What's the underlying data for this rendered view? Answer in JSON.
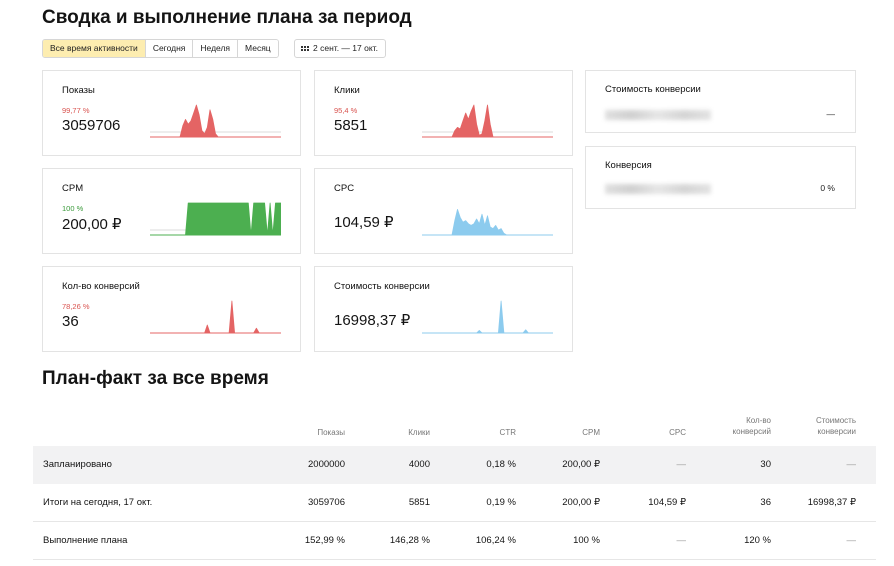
{
  "header": {
    "title": "Сводка и выполнение плана за период"
  },
  "periods": [
    {
      "label": "Все время активности",
      "active": true
    },
    {
      "label": "Сегодня",
      "active": false
    },
    {
      "label": "Неделя",
      "active": false
    },
    {
      "label": "Месяц",
      "active": false
    }
  ],
  "date_range": {
    "icon": "calendar-grid-icon",
    "label": "2 сент. — 17 окт."
  },
  "cards": [
    {
      "id": "shows",
      "label": "Показы",
      "pct": "99,77 %",
      "pct_color": "#d9534f",
      "value": "3059706",
      "spark_color": "#e46464",
      "series": [
        0,
        0,
        0,
        0,
        0,
        0,
        0,
        0,
        0,
        0,
        0,
        0,
        0.35,
        0.55,
        0.4,
        0.5,
        0.75,
        1,
        0.7,
        0.2,
        0.1,
        0.3,
        0.85,
        0.55,
        0.1,
        0,
        0,
        0,
        0,
        0,
        0,
        0,
        0,
        0,
        0,
        0,
        0,
        0,
        0,
        0,
        0,
        0,
        0,
        0,
        0,
        0,
        0,
        0,
        0
      ]
    },
    {
      "id": "clicks",
      "label": "Клики",
      "pct": "95,4 %",
      "pct_color": "#d9534f",
      "value": "5851",
      "spark_color": "#e46464",
      "series": [
        0,
        0,
        0,
        0,
        0,
        0,
        0,
        0,
        0,
        0,
        0,
        0,
        0.2,
        0.3,
        0.25,
        0.5,
        0.75,
        0.55,
        0.8,
        1,
        0.4,
        0.05,
        0.1,
        0.5,
        1,
        0.4,
        0,
        0,
        0,
        0,
        0,
        0,
        0,
        0,
        0,
        0,
        0,
        0,
        0,
        0,
        0,
        0,
        0,
        0,
        0,
        0,
        0,
        0,
        0
      ]
    },
    {
      "id": "cpm",
      "label": "CPM",
      "pct": "100 %",
      "pct_color": "#3a9a3a",
      "value": "200,00 ₽",
      "spark_color": "#4caf50",
      "series": [
        0,
        0,
        0,
        0,
        0,
        0,
        0,
        0,
        0,
        0,
        0,
        0,
        0,
        0,
        1,
        1,
        1,
        1,
        1,
        1,
        1,
        1,
        1,
        1,
        1,
        1,
        1,
        1,
        1,
        1,
        1,
        1,
        1,
        1,
        1,
        1,
        1,
        0,
        1,
        1,
        1,
        1,
        1,
        0,
        1,
        0,
        1,
        1,
        1
      ]
    },
    {
      "id": "cpc",
      "label": "CPC",
      "pct": "",
      "pct_color": "#d9534f",
      "value": "104,59 ₽",
      "spark_color": "#8ccbee",
      "series": [
        0,
        0,
        0,
        0,
        0,
        0,
        0,
        0,
        0,
        0,
        0,
        0,
        0.45,
        0.8,
        0.55,
        0.4,
        0.45,
        0.35,
        0.3,
        0.35,
        0.5,
        0.35,
        0.65,
        0.3,
        0.6,
        0.25,
        0.2,
        0.3,
        0.15,
        0.2,
        0.05,
        0,
        0,
        0,
        0,
        0,
        0,
        0,
        0,
        0,
        0,
        0,
        0,
        0,
        0,
        0,
        0,
        0,
        0
      ]
    },
    {
      "id": "conversions",
      "label": "Кол-во конверсий",
      "pct": "78,26 %",
      "pct_color": "#d9534f",
      "value": "36",
      "spark_color": "#e46464",
      "series": [
        0,
        0,
        0,
        0,
        0,
        0,
        0,
        0,
        0,
        0,
        0,
        0,
        0,
        0,
        0,
        0,
        0,
        0,
        0,
        0,
        0,
        0.25,
        0,
        0,
        0,
        0,
        0,
        0,
        0,
        0,
        1,
        0,
        0,
        0,
        0,
        0,
        0,
        0,
        0,
        0.15,
        0,
        0,
        0,
        0,
        0,
        0,
        0,
        0,
        0
      ]
    },
    {
      "id": "conv_cost",
      "label": "Стоимость конверсии",
      "pct": "",
      "pct_color": "#d9534f",
      "value": "16998,37 ₽",
      "spark_color": "#8ccbee",
      "series": [
        0,
        0,
        0,
        0,
        0,
        0,
        0,
        0,
        0,
        0,
        0,
        0,
        0,
        0,
        0,
        0,
        0,
        0,
        0,
        0,
        0,
        0.08,
        0,
        0,
        0,
        0,
        0,
        0,
        0,
        1,
        0,
        0,
        0,
        0,
        0,
        0,
        0,
        0,
        0.1,
        0,
        0,
        0,
        0,
        0,
        0,
        0,
        0,
        0,
        0
      ]
    }
  ],
  "right_cards": [
    {
      "label": "Стоимость конверсии",
      "value": "—"
    },
    {
      "label": "Конверсия",
      "value": "0 %"
    }
  ],
  "plan": {
    "title": "План-факт за все время",
    "columns": [
      "Показы",
      "Клики",
      "CTR",
      "CPM",
      "CPC",
      "Кол-во\nконверсий",
      "Стоимость\nконверсии"
    ],
    "rows": [
      {
        "label": "Запланировано",
        "cells": [
          "2000000",
          "4000",
          "0,18 %",
          "200,00 ₽",
          "—",
          "30",
          "—"
        ]
      },
      {
        "label": "Итоги на сегодня, 17 окт.",
        "cells": [
          "3059706",
          "5851",
          "0,19 %",
          "200,00 ₽",
          "104,59 ₽",
          "36",
          "16998,37 ₽"
        ]
      },
      {
        "label": "Выполнение плана",
        "cells": [
          "152,99 %",
          "146,28 %",
          "106,24 %",
          "100 %",
          "—",
          "120 %",
          "—"
        ]
      }
    ]
  }
}
